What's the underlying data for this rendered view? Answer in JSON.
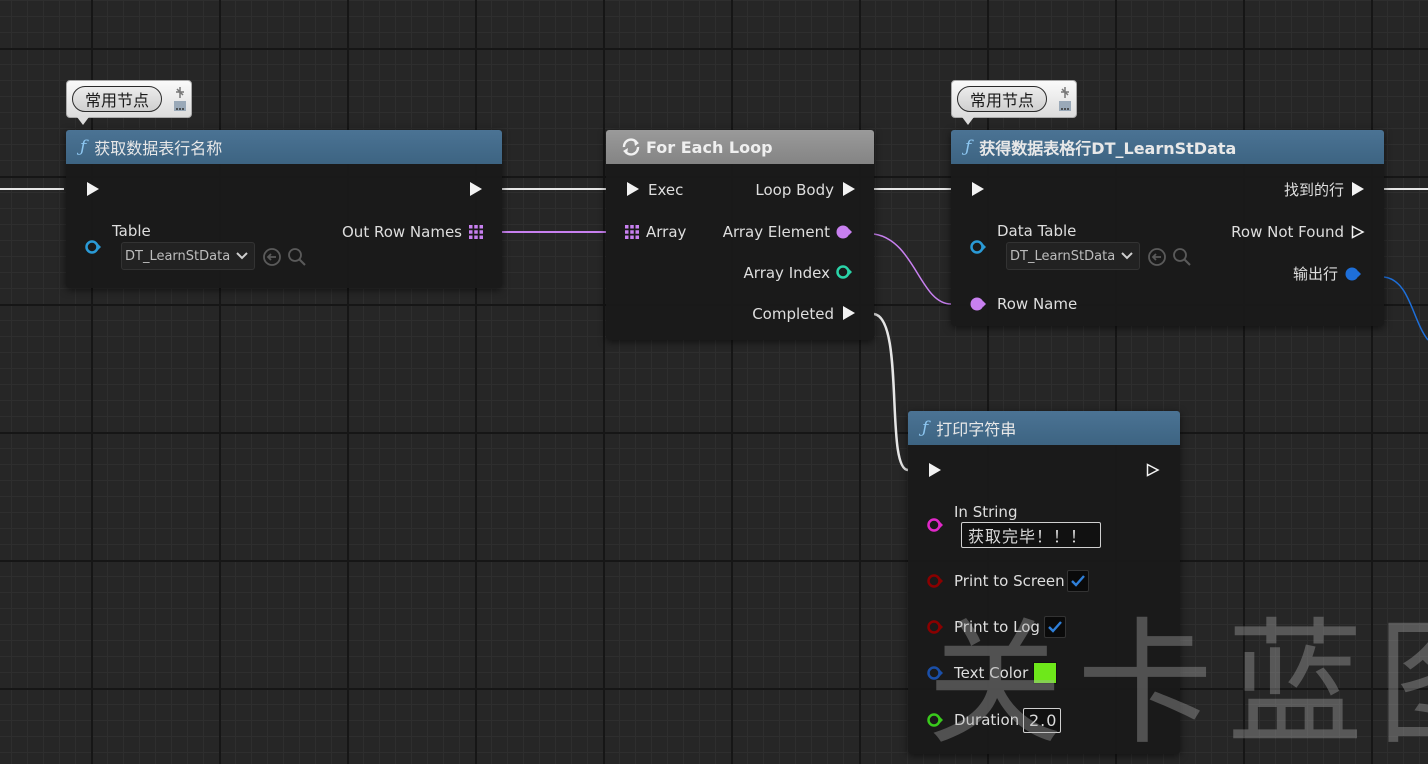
{
  "nodes": {
    "get_row_names": {
      "bubble": "常用节点",
      "title": "获取数据表行名称",
      "table_label": "Table",
      "table_value": "DT_LearnStData",
      "out_label": "Out Row Names"
    },
    "for_each": {
      "title": "For Each Loop",
      "exec_label": "Exec",
      "array_label": "Array",
      "loop_body_label": "Loop Body",
      "array_element_label": "Array Element",
      "array_index_label": "Array Index",
      "completed_label": "Completed"
    },
    "get_row": {
      "bubble": "常用节点",
      "title": "获得数据表格行DT_LearnStData",
      "data_table_label": "Data Table",
      "data_table_value": "DT_LearnStData",
      "row_name_label": "Row Name",
      "found_label": "找到的行",
      "not_found_label": "Row Not Found",
      "out_row_label": "输出行"
    },
    "print_string": {
      "title": "打印字符串",
      "in_string_label": "In String",
      "in_string_value": "获取完毕！！！",
      "print_screen_label": "Print to Screen",
      "print_log_label": "Print to Log",
      "text_color_label": "Text Color",
      "duration_label": "Duration",
      "duration_value": "2.0"
    }
  },
  "watermark": "关卡蓝图",
  "colors": {
    "header_blue": "#436b8a",
    "header_gray": "#8f8f8f",
    "exec_white": "#f2f2f2",
    "array_name_purple": "#c880f0",
    "struct_blue": "#1e6fd9",
    "table_cyan": "#2a9ad6",
    "int_teal": "#2ad3a8",
    "string_magenta": "#e028c8",
    "bool_red": "#8a0000",
    "color_struct_blue": "#1a4fa8",
    "float_green": "#39c91c",
    "text_color_value": "#6ee81a",
    "checkbox_blue": "#2f7fd8"
  }
}
